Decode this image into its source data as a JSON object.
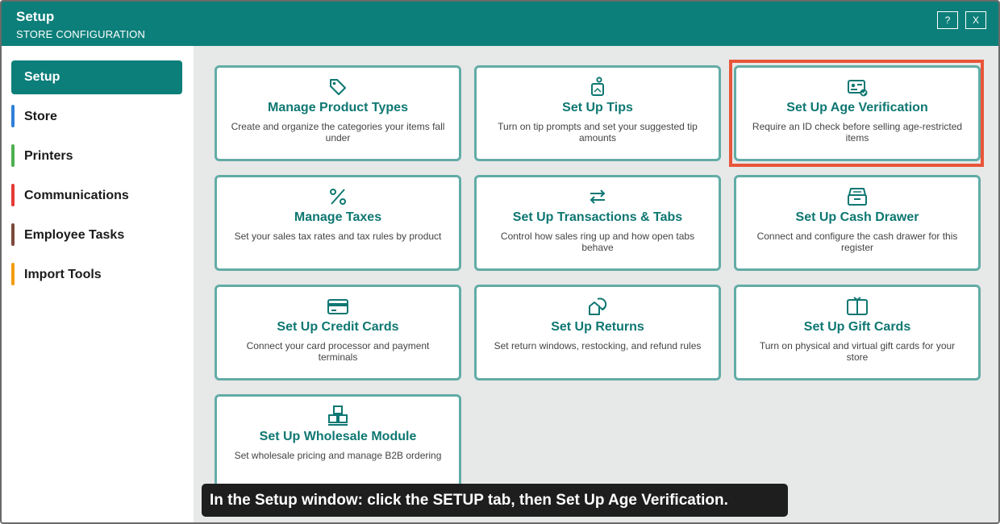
{
  "window": {
    "title": "Setup",
    "subtitle": "STORE CONFIGURATION",
    "help_label": "?",
    "close_label": "X"
  },
  "sidebar": {
    "items": [
      {
        "label": "Setup",
        "active": true,
        "color": "#0d7f7a"
      },
      {
        "label": "Store",
        "color": "#2f7fd8"
      },
      {
        "label": "Printers",
        "color": "#4caf50"
      },
      {
        "label": "Communications",
        "color": "#e53935"
      },
      {
        "label": "Employee Tasks",
        "color": "#7b4a3a"
      },
      {
        "label": "Import Tools",
        "color": "#f39c12"
      }
    ]
  },
  "cards": [
    {
      "icon": "tag-icon",
      "title": "Manage Product Types",
      "desc": "Create and organize the categories your items fall under"
    },
    {
      "icon": "tip-jar-icon",
      "title": "Set Up Tips",
      "desc": "Turn on tip prompts and set your suggested tip amounts"
    },
    {
      "icon": "id-card-check-icon",
      "title": "Set Up Age Verification",
      "desc": "Require an ID check before selling age-restricted items"
    },
    {
      "icon": "percent-icon",
      "title": "Manage Taxes",
      "desc": "Set your sales tax rates and tax rules by product"
    },
    {
      "icon": "arrows-swap-icon",
      "title": "Set Up Transactions & Tabs",
      "desc": "Control how sales ring up and how open tabs behave"
    },
    {
      "icon": "cash-drawer-icon",
      "title": "Set Up Cash Drawer",
      "desc": "Connect and configure the cash drawer for this register"
    },
    {
      "icon": "credit-card-icon",
      "title": "Set Up Credit Cards",
      "desc": "Connect your card processor and payment terminals"
    },
    {
      "icon": "return-icon",
      "title": "Set Up Returns",
      "desc": "Set return windows, restocking, and refund rules"
    },
    {
      "icon": "gift-card-icon",
      "title": "Set Up Gift Cards",
      "desc": "Turn on physical and virtual gift cards for your store"
    },
    {
      "icon": "boxes-icon",
      "title": "Set Up Wholesale Module",
      "desc": "Set wholesale pricing and manage B2B ordering"
    }
  ],
  "caption": "In the Setup window: click the SETUP tab, then Set Up Age Verification.",
  "colors": {
    "accent": "#0d7f7a",
    "card_border": "#62aca6",
    "highlight": "#e8553a"
  }
}
